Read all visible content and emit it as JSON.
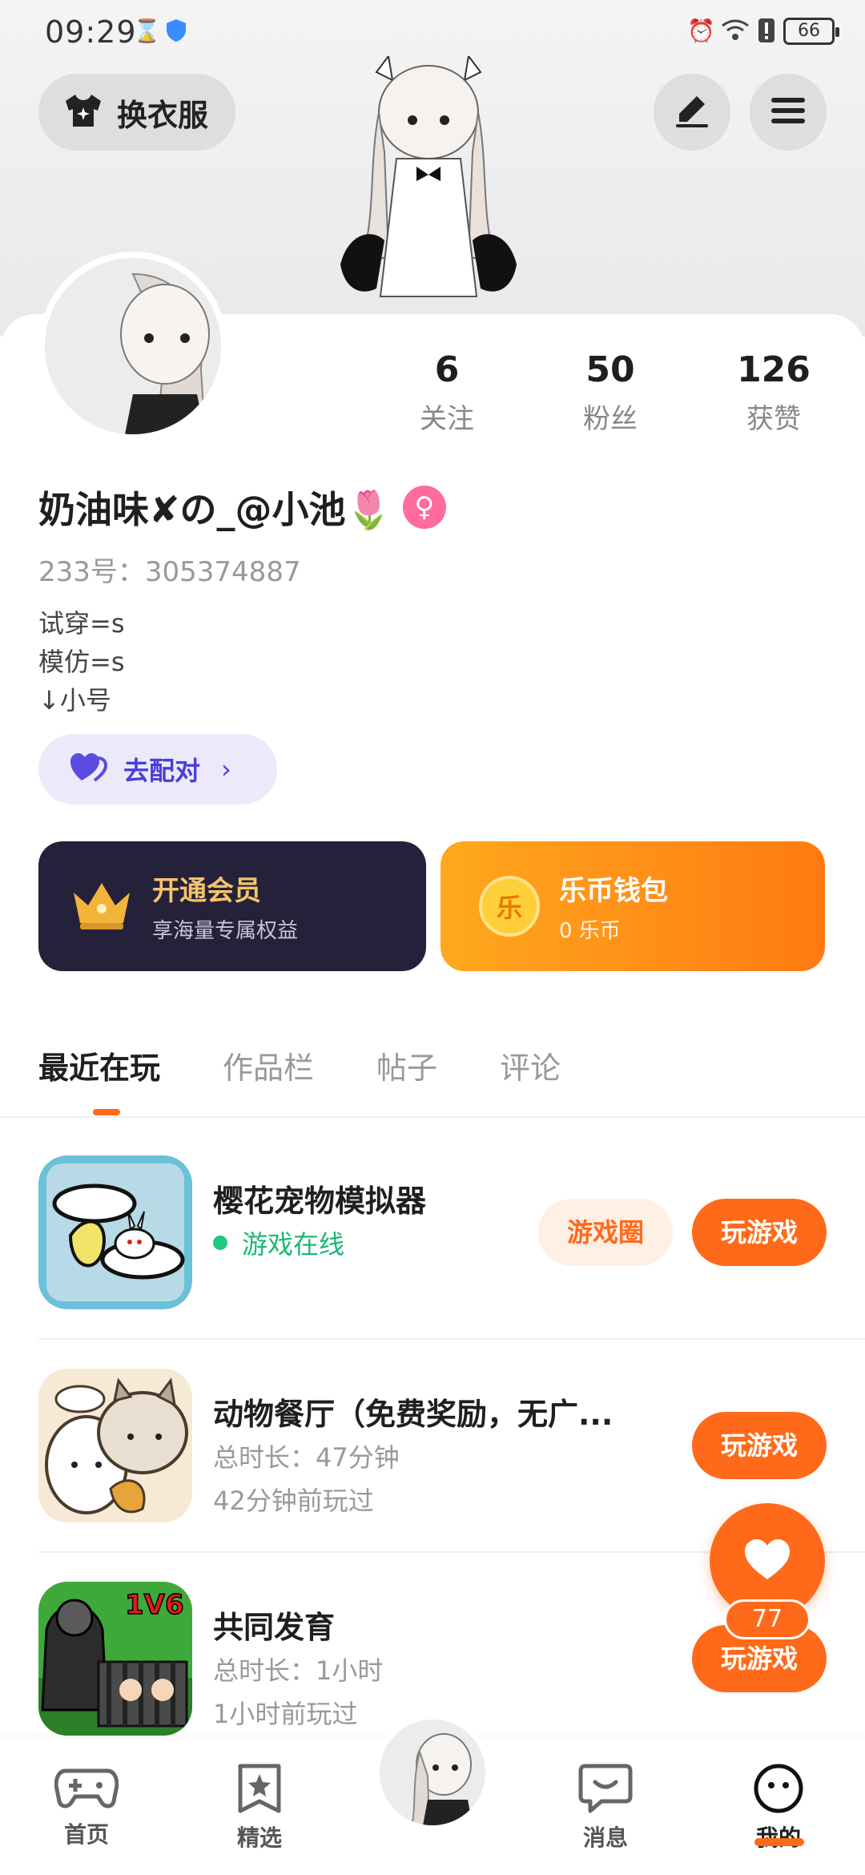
{
  "status_bar": {
    "time": "09:29",
    "battery": "66"
  },
  "header": {
    "outfit_label": "换衣服"
  },
  "profile": {
    "stats": [
      {
        "value": "6",
        "label": "关注"
      },
      {
        "value": "50",
        "label": "粉丝"
      },
      {
        "value": "126",
        "label": "获赞"
      }
    ],
    "name": "奶油味✘の_@小池🌷",
    "gender_symbol": "♀",
    "uid": "233号：305374887",
    "bio": [
      "试穿=s",
      "模仿=s",
      "↓小号"
    ],
    "match_label": "去配对"
  },
  "promo": {
    "vip": {
      "title": "开通会员",
      "subtitle": "享海量专属权益"
    },
    "wallet": {
      "title": "乐币钱包",
      "subtitle": "0 乐币",
      "coin_glyph": "乐"
    }
  },
  "tabs": [
    "最近在玩",
    "作品栏",
    "帖子",
    "评论"
  ],
  "games": [
    {
      "title": "樱花宠物模拟器",
      "line1": "游戏在线",
      "line2": "",
      "circle_label": "游戏圈",
      "play_label": "玩游戏"
    },
    {
      "title": "动物餐厅（免费奖励，无广...",
      "line1": "总时长：47分钟",
      "line2": "42分钟前玩过",
      "play_label": "玩游戏"
    },
    {
      "title": "共同发育",
      "line1": "总时长：1小时",
      "line2": "1小时前玩过",
      "play_label": "玩游戏",
      "badge": "1V6"
    }
  ],
  "fab": {
    "count": "77"
  },
  "bottom_nav": [
    {
      "label": "首页"
    },
    {
      "label": "精选"
    },
    {
      "label": "消息"
    },
    {
      "label": "我的"
    }
  ],
  "colors": {
    "accent": "#ff6a1a",
    "online": "#1cb874",
    "vip_bg": "#25213a",
    "match_text": "#4a3fd6"
  }
}
